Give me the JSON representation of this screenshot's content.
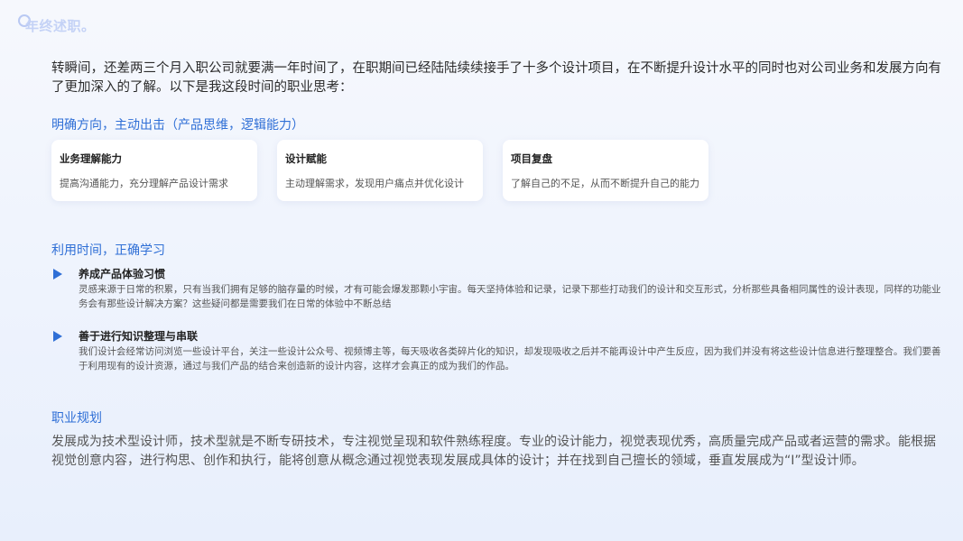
{
  "brand": {
    "logo_text": "年终述职。"
  },
  "intro": "转瞬间，还差两三个月入职公司就要满一年时间了，在职期间已经陆陆续续接手了十多个设计项目，在不断提升设计水平的同时也对公司业务和发展方向有了更加深入的了解。以下是我这段时间的职业思考：",
  "section1": {
    "title": "明确方向，主动出击（产品思维，逻辑能力）",
    "cards": [
      {
        "title": "业务理解能力",
        "desc": "提高沟通能力，充分理解产品设计需求"
      },
      {
        "title": "设计赋能",
        "desc": "主动理解需求，发现用户痛点并优化设计"
      },
      {
        "title": "项目复盘",
        "desc": "了解自己的不足，从而不断提升自己的能力"
      }
    ]
  },
  "section2": {
    "title": "利用时间，正确学习",
    "points": [
      {
        "title": "养成产品体验习惯",
        "body": "灵感来源于日常的积累，只有当我们拥有足够的脑存量的时候，才有可能会爆发那颗小宇宙。每天坚持体验和记录，记录下那些打动我们的设计和交互形式，分析那些具备相同属性的设计表现，同样的功能业务会有那些设计解决方案？这些疑问都是需要我们在日常的体验中不断总结"
      },
      {
        "title": "善于进行知识整理与串联",
        "body": "我们设计会经常访问浏览一些设计平台，关注一些设计公众号、视频博主等，每天吸收各类碎片化的知识，却发现吸收之后并不能再设计中产生反应，因为我们并没有将这些设计信息进行整理整合。我们要善于利用现有的设计资源，通过与我们产品的结合来创造新的设计内容，这样才会真正的成为我们的作品。"
      }
    ]
  },
  "section3": {
    "title": "职业规划",
    "body": "发展成为技术型设计师，技术型就是不断专研技术，专注视觉呈现和软件熟练程度。专业的设计能力，视觉表现优秀，高质量完成产品或者运营的需求。能根据视觉创意内容，进行构思、创作和执行，能将创意从概念通过视觉表现发展成具体的设计；并在找到自己擅长的领域，垂直发展成为“I”型设计师。"
  },
  "colors": {
    "accent": "#2f6fd6",
    "logo": "#c4d2f6",
    "background": "#eef3fd"
  }
}
